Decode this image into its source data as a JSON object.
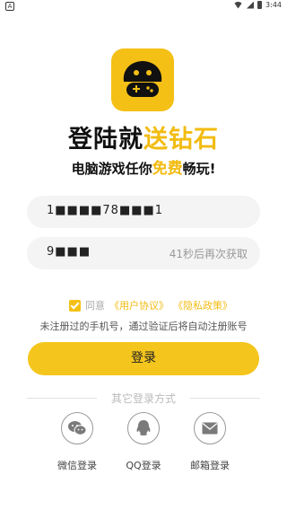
{
  "status": {
    "time": "3:44"
  },
  "slogan": {
    "line1_a": "登陆就",
    "line1_b": "送钻石",
    "line2_a": "电脑游戏任你",
    "line2_b": "免费",
    "line2_c": "畅玩!"
  },
  "form": {
    "phone_value": "1■■■■78■■■1",
    "code_value": "9■■■",
    "countdown": "41秒后再次获取"
  },
  "agreement": {
    "prefix": "同意",
    "user_agreement": "《用户协议》",
    "privacy": "《隐私政策》",
    "checked": true
  },
  "hint": "未注册过的手机号，通过验证后将自动注册账号",
  "login_button": "登录",
  "other_login": {
    "title": "其它登录方式",
    "wechat": "微信登录",
    "qq": "QQ登录",
    "email": "邮箱登录"
  },
  "colors": {
    "accent": "#f4c51d",
    "link": "#f2bb10"
  }
}
